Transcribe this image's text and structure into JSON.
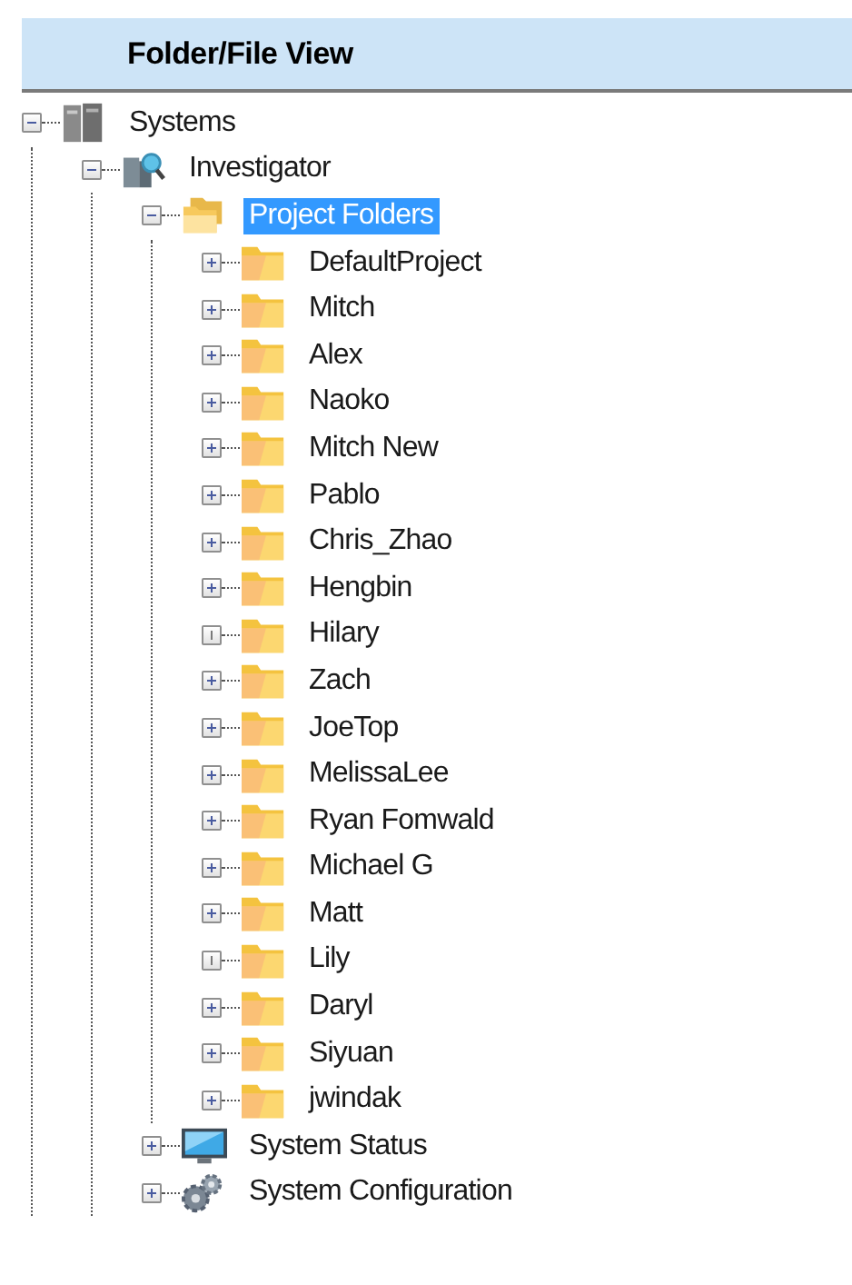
{
  "header": {
    "title": "Folder/File View"
  },
  "tree": [
    {
      "label": "Systems",
      "kind": "servers",
      "expanded": true,
      "has_children": true,
      "selected": false,
      "children": [
        {
          "label": "Investigator",
          "kind": "investigator",
          "expanded": true,
          "has_children": true,
          "selected": false,
          "children": [
            {
              "label": "Project Folders",
              "kind": "folders",
              "expanded": true,
              "has_children": true,
              "selected": true,
              "children": [
                {
                  "label": "DefaultProject",
                  "kind": "folder",
                  "expanded": false,
                  "has_children": true,
                  "selected": false
                },
                {
                  "label": "Mitch",
                  "kind": "folder",
                  "expanded": false,
                  "has_children": true,
                  "selected": false
                },
                {
                  "label": "Alex",
                  "kind": "folder",
                  "expanded": false,
                  "has_children": true,
                  "selected": false
                },
                {
                  "label": "Naoko",
                  "kind": "folder",
                  "expanded": false,
                  "has_children": true,
                  "selected": false
                },
                {
                  "label": "Mitch New",
                  "kind": "folder",
                  "expanded": false,
                  "has_children": true,
                  "selected": false
                },
                {
                  "label": "Pablo",
                  "kind": "folder",
                  "expanded": false,
                  "has_children": true,
                  "selected": false
                },
                {
                  "label": "Chris_Zhao",
                  "kind": "folder",
                  "expanded": false,
                  "has_children": true,
                  "selected": false
                },
                {
                  "label": "Hengbin",
                  "kind": "folder",
                  "expanded": false,
                  "has_children": true,
                  "selected": false
                },
                {
                  "label": "Hilary",
                  "kind": "folder",
                  "has_children": false,
                  "selected": false
                },
                {
                  "label": "Zach",
                  "kind": "folder",
                  "expanded": false,
                  "has_children": true,
                  "selected": false
                },
                {
                  "label": "JoeTop",
                  "kind": "folder",
                  "expanded": false,
                  "has_children": true,
                  "selected": false
                },
                {
                  "label": "MelissaLee",
                  "kind": "folder",
                  "expanded": false,
                  "has_children": true,
                  "selected": false
                },
                {
                  "label": "Ryan Fomwald",
                  "kind": "folder",
                  "expanded": false,
                  "has_children": true,
                  "selected": false
                },
                {
                  "label": "Michael G",
                  "kind": "folder",
                  "expanded": false,
                  "has_children": true,
                  "selected": false
                },
                {
                  "label": "Matt",
                  "kind": "folder",
                  "expanded": false,
                  "has_children": true,
                  "selected": false
                },
                {
                  "label": "Lily",
                  "kind": "folder",
                  "has_children": false,
                  "selected": false
                },
                {
                  "label": "Daryl",
                  "kind": "folder",
                  "expanded": false,
                  "has_children": true,
                  "selected": false
                },
                {
                  "label": "Siyuan",
                  "kind": "folder",
                  "expanded": false,
                  "has_children": true,
                  "selected": false
                },
                {
                  "label": "jwindak",
                  "kind": "folder",
                  "expanded": false,
                  "has_children": true,
                  "selected": false
                }
              ]
            },
            {
              "label": "System Status",
              "kind": "monitor",
              "expanded": false,
              "has_children": true,
              "selected": false
            },
            {
              "label": "System Configuration",
              "kind": "gears",
              "expanded": false,
              "has_children": true,
              "selected": false
            }
          ]
        }
      ]
    }
  ]
}
